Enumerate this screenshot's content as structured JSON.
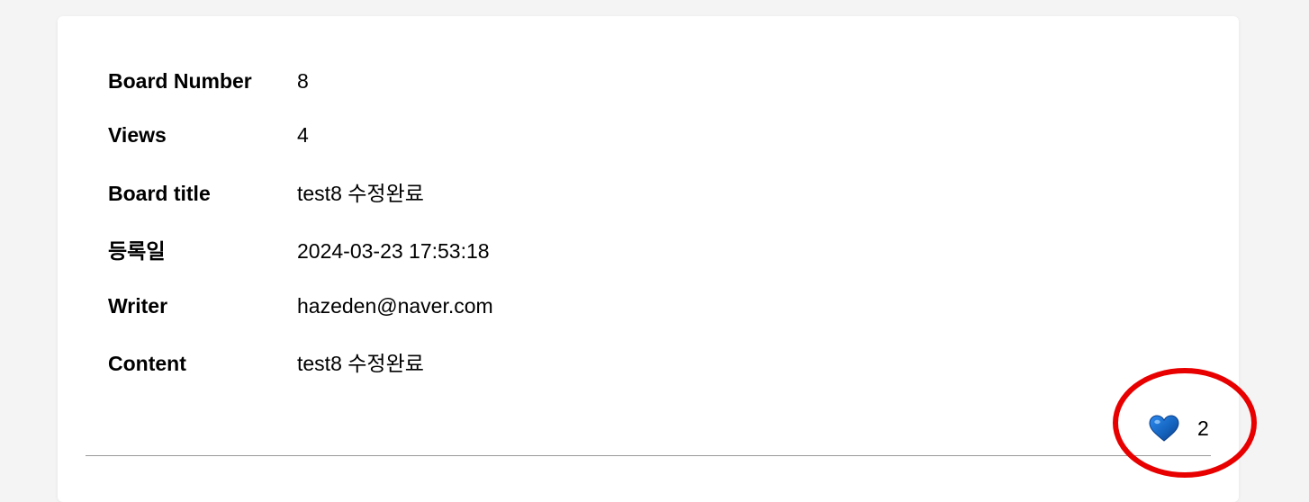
{
  "detail": {
    "rows": [
      {
        "label": "Board Number",
        "value": "8"
      },
      {
        "label": "Views",
        "value": "4"
      },
      {
        "label": "Board title",
        "value": "test8 수정완료"
      },
      {
        "label": "등록일",
        "value": "2024-03-23 17:53:18"
      },
      {
        "label": "Writer",
        "value": "hazeden@naver.com"
      },
      {
        "label": "Content",
        "value": "test8 수정완료"
      }
    ]
  },
  "like": {
    "icon": "blue-heart-icon",
    "count": "2",
    "color": "#1565c0"
  },
  "annotation": {
    "color": "#e80000"
  }
}
